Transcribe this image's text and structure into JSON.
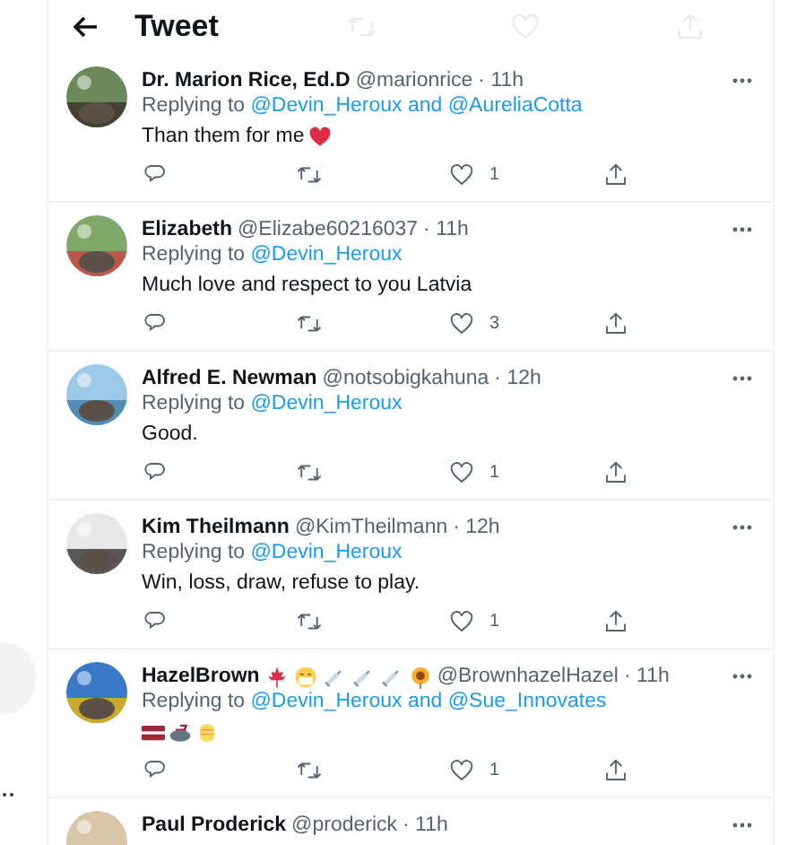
{
  "header": {
    "title": "Tweet"
  },
  "tweets": [
    {
      "name": "Dr. Marion Rice, Ed.D",
      "handle": "@marionrice",
      "time": "· 11h",
      "replying_label": "Replying to",
      "replying_to": "@Devin_Heroux and @AureliaCotta",
      "text": "Than them for me",
      "text_emoji": [
        {
          "kind": "heart"
        }
      ],
      "likes": "1"
    },
    {
      "name": "Elizabeth",
      "handle": "@Elizabe60216037",
      "time": "· 11h",
      "replying_label": "Replying to",
      "replying_to": "@Devin_Heroux",
      "text": "Much love and respect to you Latvia",
      "likes": "3"
    },
    {
      "name": "Alfred E. Newman",
      "handle": "@notsobigkahuna",
      "time": "· 12h",
      "replying_label": "Replying to",
      "replying_to": "@Devin_Heroux",
      "text": "Good.",
      "likes": "1"
    },
    {
      "name": "Kim Theilmann",
      "handle": "@KimTheilmann",
      "time": "· 12h",
      "replying_label": "Replying to",
      "replying_to": "@Devin_Heroux",
      "text": "Win, loss, draw, refuse to play.",
      "likes": "1"
    },
    {
      "name": "HazelBrown",
      "name_emoji": [
        {
          "kind": "maple-leaf"
        },
        {
          "kind": "mask-face"
        },
        {
          "kind": "syringe"
        },
        {
          "kind": "syringe"
        },
        {
          "kind": "syringe"
        },
        {
          "kind": "sunflower"
        }
      ],
      "handle": "@BrownhazelHazel",
      "time": "· 11h",
      "replying_label": "Replying to",
      "replying_to": "@Devin_Heroux and @Sue_Innovates",
      "text_emoji": [
        {
          "kind": "flag"
        },
        {
          "kind": "curling-stone"
        },
        {
          "kind": "fist"
        }
      ],
      "likes": "1"
    },
    {
      "name": "Paul Proderick",
      "handle": "@proderick",
      "time": "· 11h"
    }
  ]
}
